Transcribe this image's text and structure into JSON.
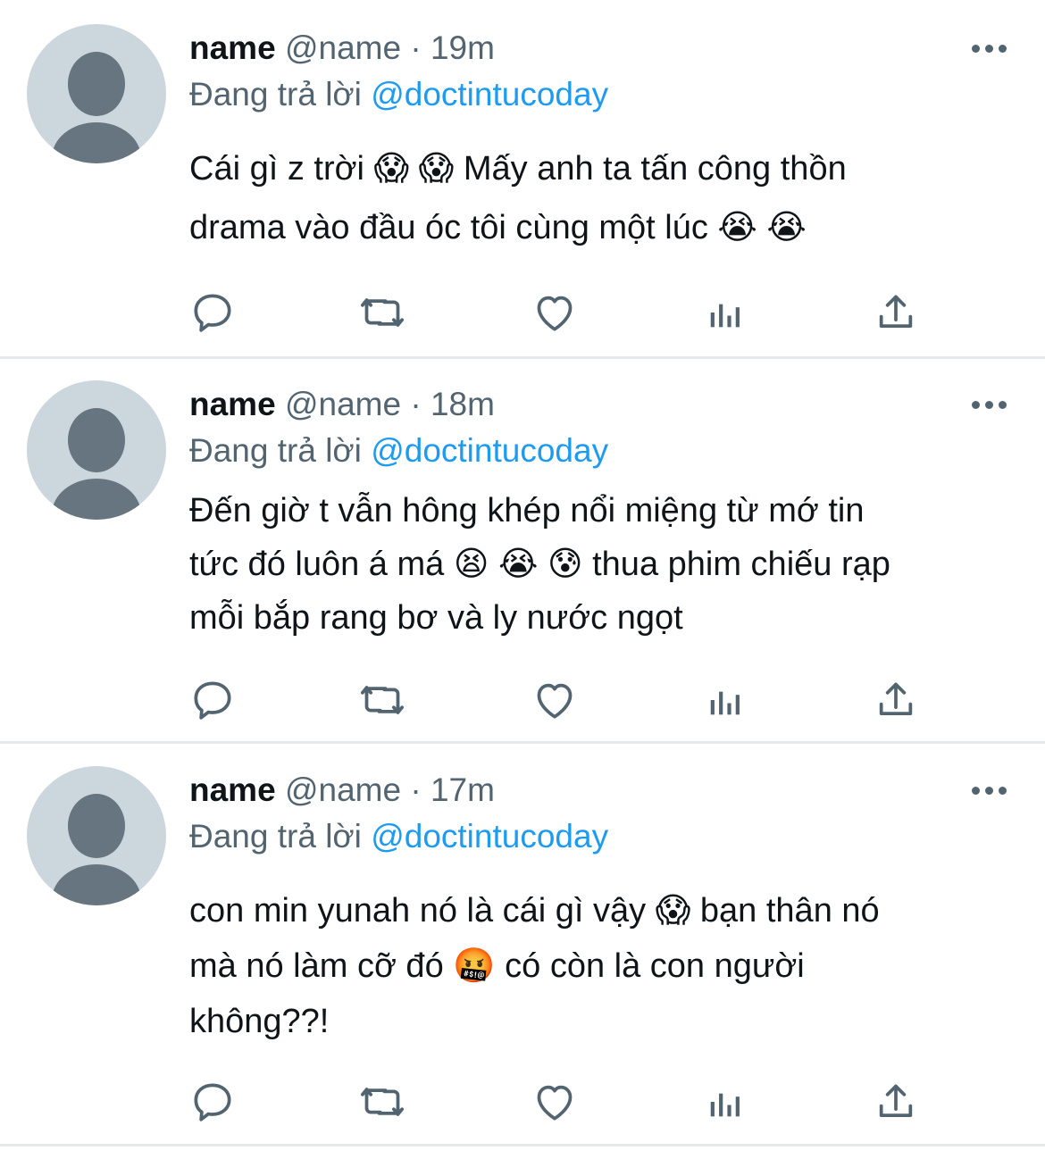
{
  "colors": {
    "text_primary": "#0f1419",
    "text_secondary": "#536471",
    "mention": "#1d9bf0",
    "avatar_bg": "#ccd6dd",
    "avatar_fg": "#66757f",
    "separator": "#e6e9ec"
  },
  "icons": [
    "avatar-placeholder-icon",
    "more-dots-icon",
    "reply-icon",
    "retweet-icon",
    "like-icon",
    "views-icon",
    "share-icon"
  ],
  "tweets": [
    {
      "name": "name",
      "handle": "@name",
      "dot": "·",
      "time": "19m",
      "reply_prefix": "Đang trả lời",
      "reply_to": "@doctintucoday",
      "lines": [
        "Cái gì z trời 😱 😱  Mấy anh ta tấn công thồn",
        "drama vào đầu óc tôi cùng một lúc 😭 😭"
      ]
    },
    {
      "name": "name",
      "handle": "@name",
      "dot": "·",
      "time": "18m",
      "reply_prefix": "Đang trả lời",
      "reply_to": "@doctintucoday",
      "lines": [
        "Đến giờ t vẫn hông khép nổi miệng từ mớ tin",
        "tức đó luôn á má 😫 😭 😰 thua phim chiếu rạp",
        "mỗi bắp rang bơ và ly nước ngọt"
      ]
    },
    {
      "name": "name",
      "handle": "@name",
      "dot": "·",
      "time": "17m",
      "reply_prefix": "Đang trả lời",
      "reply_to": "@doctintucoday",
      "lines": [
        "con min yunah nó là cái gì vậy 😱  bạn thân nó",
        "mà nó làm cỡ đó 🤬  có còn là con người",
        "không??!"
      ]
    }
  ]
}
